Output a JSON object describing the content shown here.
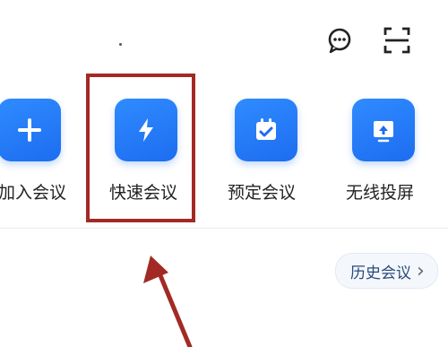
{
  "header": {
    "chat_icon": "message-bubble-icon",
    "scan_icon": "scan-frame-icon"
  },
  "actions": [
    {
      "label": "加入会议",
      "icon": "plus-icon"
    },
    {
      "label": "快速会议",
      "icon": "lightning-icon"
    },
    {
      "label": "预定会议",
      "icon": "calendar-check-icon"
    },
    {
      "label": "无线投屏",
      "icon": "screen-cast-icon"
    }
  ],
  "history": {
    "label": "历史会议",
    "chevron": "›"
  },
  "colors": {
    "accent": "#1d6df0",
    "highlight": "#a32a24"
  }
}
